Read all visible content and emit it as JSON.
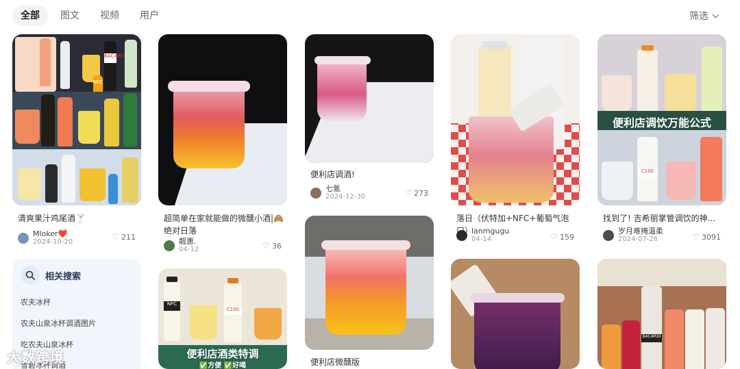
{
  "tabs": [
    "全部",
    "图文",
    "视频",
    "用户"
  ],
  "filter_label": "筛选",
  "cards": [
    {
      "title": "清爽果汁鸡尾酒🍸",
      "author": "Mloker❤️",
      "date": "2024-10-20",
      "likes": "211"
    },
    {
      "title": "超简单在家就能做的微醺小酒|🙈绝对日落",
      "author": "靓惠.",
      "date": "04-12",
      "likes": "36"
    },
    {
      "title": "便利店调酒!",
      "author": "七氪",
      "date": "2024-12-30",
      "likes": "273"
    },
    {
      "title": "落日（伏特加+NFC+葡萄气泡口）",
      "author": "lanmgugu",
      "date": "04-14",
      "likes": "159"
    },
    {
      "title": "找到了! 吉希丽掌管调饮的神...",
      "author": "岁月难掩温柔",
      "date": "2024-07-26",
      "likes": "3091"
    },
    {
      "title": "便利店微醺版"
    }
  ],
  "image_text": {
    "card5_overlay": "便利店调饮万能公式",
    "card7_overlay_line1": "便利店酒类特调",
    "card7_overlay_line2": "✅方便 ✅好喝",
    "nfc": "NFC",
    "c100": "C100",
    "bacardi": "BACARDI"
  },
  "related": {
    "title": "相关搜索",
    "items": [
      "农夫冰杯",
      "农夫山泉冰杯调酒图片",
      "吃农夫山泉冰杯",
      "雪碧冰杯调酒"
    ]
  },
  "watermark": "大数跨境",
  "colors": {
    "accent": "#ff2442",
    "related_bg": "#f1f6fd"
  }
}
